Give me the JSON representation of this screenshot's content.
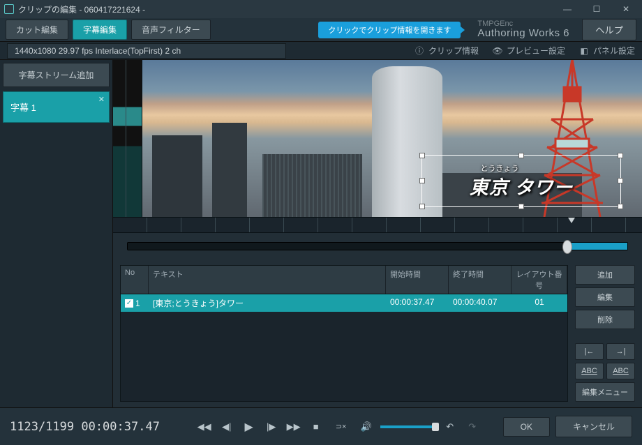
{
  "window": {
    "title": "クリップの編集 - 060417221624 -"
  },
  "tabs": {
    "cut": "カット編集",
    "subtitle": "字幕編集",
    "audio": "音声フィルター"
  },
  "info_bubble": "クリックでクリップ情報を開きます",
  "brand": {
    "line1": "TMPGEnc",
    "line2": "Authoring Works 6"
  },
  "help": "ヘルプ",
  "clip_spec": "1440x1080 29.97 fps Interlace(TopFirst)  2 ch",
  "links": {
    "clip_info": "クリップ情報",
    "preview": "プレビュー設定",
    "panel": "パネル設定"
  },
  "sidebar": {
    "add_stream": "字幕ストリーム追加",
    "stream1": "字幕 1"
  },
  "subtitle_overlay": {
    "ruby": "とうきょう",
    "text": "東京 タワー"
  },
  "table": {
    "headers": {
      "no": "No",
      "text": "テキスト",
      "start": "開始時間",
      "end": "終了時間",
      "layout": "レイアウト番号"
    },
    "rows": [
      {
        "no": "1",
        "text": "[東京;とうきょう]タワー",
        "start": "00:00:37.47",
        "end": "00:00:40.07",
        "layout": "01"
      }
    ]
  },
  "buttons": {
    "add": "追加",
    "edit": "編集",
    "delete": "削除",
    "menu": "編集メニュー",
    "abc_l": "ABC",
    "abc_r": "ABC"
  },
  "bottom": {
    "timecode": "1123/1199  00:00:37.47",
    "ok": "OK",
    "cancel": "キャンセル"
  }
}
